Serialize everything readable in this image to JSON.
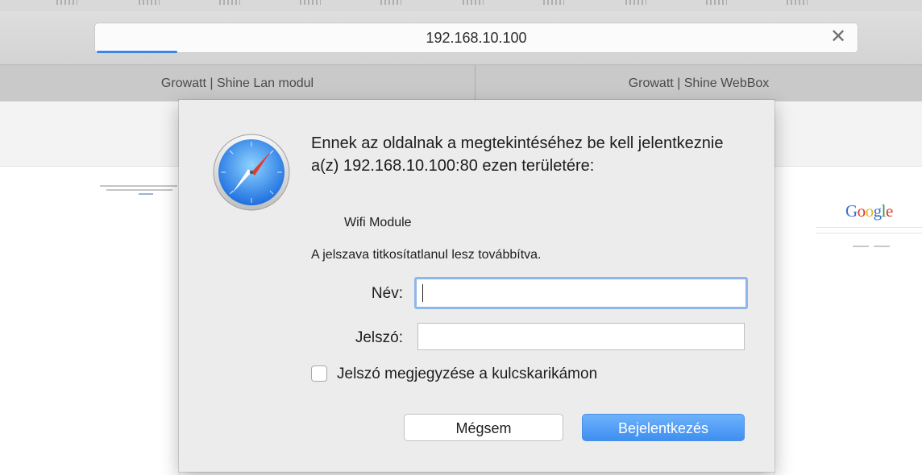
{
  "browser": {
    "address_bar": {
      "url": "192.168.10.100",
      "clear_icon": "close-icon"
    },
    "tabs": [
      {
        "label": "Growatt | Shine Lan modul"
      },
      {
        "label": "Growatt | Shine WebBox"
      }
    ]
  },
  "background_page": {
    "google_logo": "Google"
  },
  "auth_dialog": {
    "icon": "safari-compass-icon",
    "message": "Ennek az oldalnak a megtekintéséhez be kell jelentkeznie a(z) 192.168.10.100:80 ezen területére:",
    "realm": "Wifi Module",
    "warning": "A jelszava titkosítatlanul lesz továbbítva.",
    "username": {
      "label": "Név:",
      "value": ""
    },
    "password": {
      "label": "Jelszó:",
      "value": ""
    },
    "remember": {
      "label": "Jelszó megjegyzése a kulcskarikámon",
      "checked": false
    },
    "buttons": {
      "cancel": "Mégsem",
      "login": "Bejelentkezés"
    }
  },
  "colors": {
    "accent": "#3f8ff1",
    "focus_ring": "#8fb5ea"
  }
}
